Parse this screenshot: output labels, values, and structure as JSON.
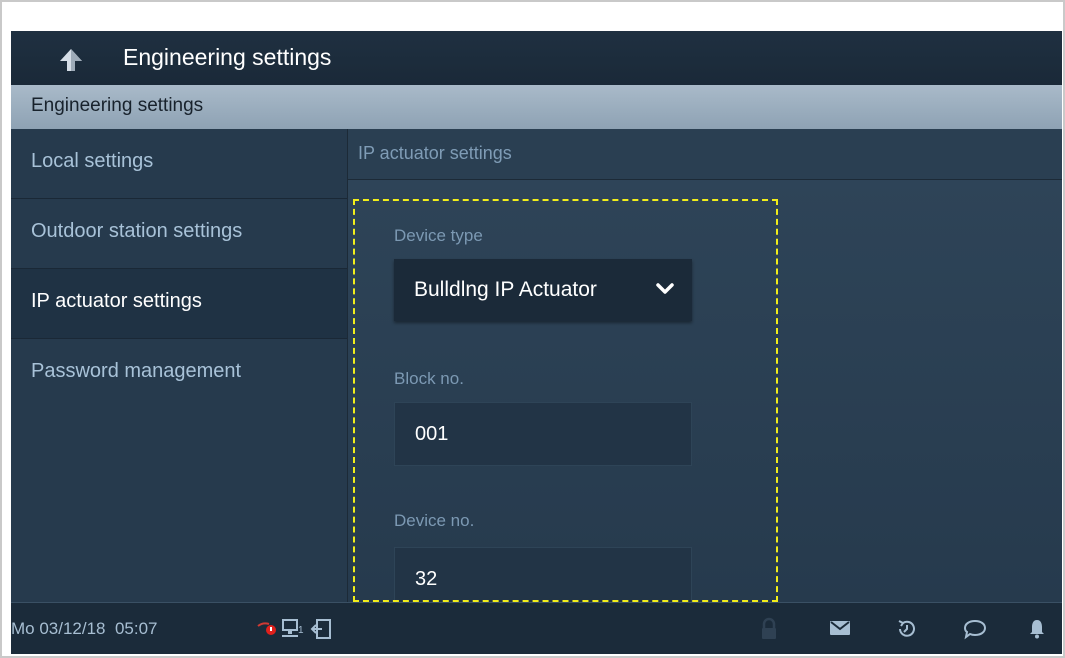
{
  "header": {
    "title": "Engineering settings",
    "back_icon": "back-arrow-icon"
  },
  "subheader": {
    "title": "Engineering settings"
  },
  "sidebar": {
    "items": [
      {
        "label": "Local settings",
        "active": false
      },
      {
        "label": "Outdoor station settings",
        "active": false
      },
      {
        "label": "IP actuator settings",
        "active": true
      },
      {
        "label": "Password management",
        "active": false
      }
    ]
  },
  "content": {
    "section_title": "IP actuator settings",
    "device_type": {
      "label": "Device type",
      "value": "Bulldlng IP Actuator"
    },
    "block_no": {
      "label": "Block no.",
      "value": "001"
    },
    "device_no": {
      "label": "Device no.",
      "value": "32"
    }
  },
  "statusbar": {
    "datetime": "Mo 03/12/18  05:07",
    "network_count": "1",
    "icons": [
      "camera-alert-icon",
      "network-icon",
      "logout-icon",
      "lock-icon",
      "mail-icon",
      "history-icon",
      "message-icon",
      "bell-icon"
    ]
  },
  "colors": {
    "accent_highlight": "#f2ee1a",
    "alert_red": "#e0201c",
    "background": "#26394a"
  }
}
